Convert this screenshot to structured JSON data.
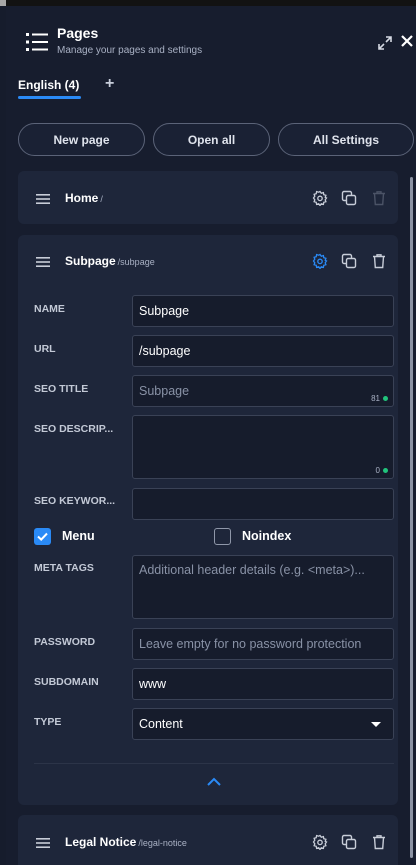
{
  "header": {
    "title": "Pages",
    "subtitle": "Manage your pages and settings"
  },
  "tabs": [
    {
      "label": "English (4)",
      "active": true
    }
  ],
  "toolbar": {
    "new_page": "New page",
    "open_all": "Open all",
    "all_settings": "All Settings"
  },
  "pages": {
    "home": {
      "title": "Home",
      "slug": "/"
    },
    "subpage": {
      "title": "Subpage",
      "slug": "/subpage",
      "form": {
        "name": {
          "label": "NAME",
          "value": "Subpage"
        },
        "url": {
          "label": "URL",
          "value": "/subpage"
        },
        "seo_title": {
          "label": "SEO TITLE",
          "placeholder": "Subpage",
          "counter": "81"
        },
        "seo_description": {
          "label": "SEO DESCRIP...",
          "value": "",
          "counter": "0"
        },
        "seo_keywords": {
          "label": "SEO KEYWOR...",
          "value": ""
        },
        "menu": {
          "label": "Menu",
          "checked": true
        },
        "noindex": {
          "label": "Noindex",
          "checked": false
        },
        "meta_tags": {
          "label": "META TAGS",
          "placeholder": "Additional header details (e.g. <meta>)..."
        },
        "password": {
          "label": "PASSWORD",
          "placeholder": "Leave empty for no password protection"
        },
        "subdomain": {
          "label": "SUBDOMAIN",
          "value": "www"
        },
        "type": {
          "label": "TYPE",
          "value": "Content"
        }
      }
    },
    "legal": {
      "title": "Legal Notice",
      "slug": "/legal-notice"
    }
  },
  "icons": {
    "header": "list-icon",
    "expand": "expand-icon",
    "close": "close-icon",
    "drag": "drag-handle-icon",
    "settings": "settings-icon",
    "duplicate": "duplicate-icon",
    "delete": "trash-icon",
    "collapse": "chevron-up-icon"
  },
  "colors": {
    "accent": "#2a8af6",
    "counter_ok": "#21c47c",
    "background": "#161c2c",
    "card": "#1e263a"
  }
}
